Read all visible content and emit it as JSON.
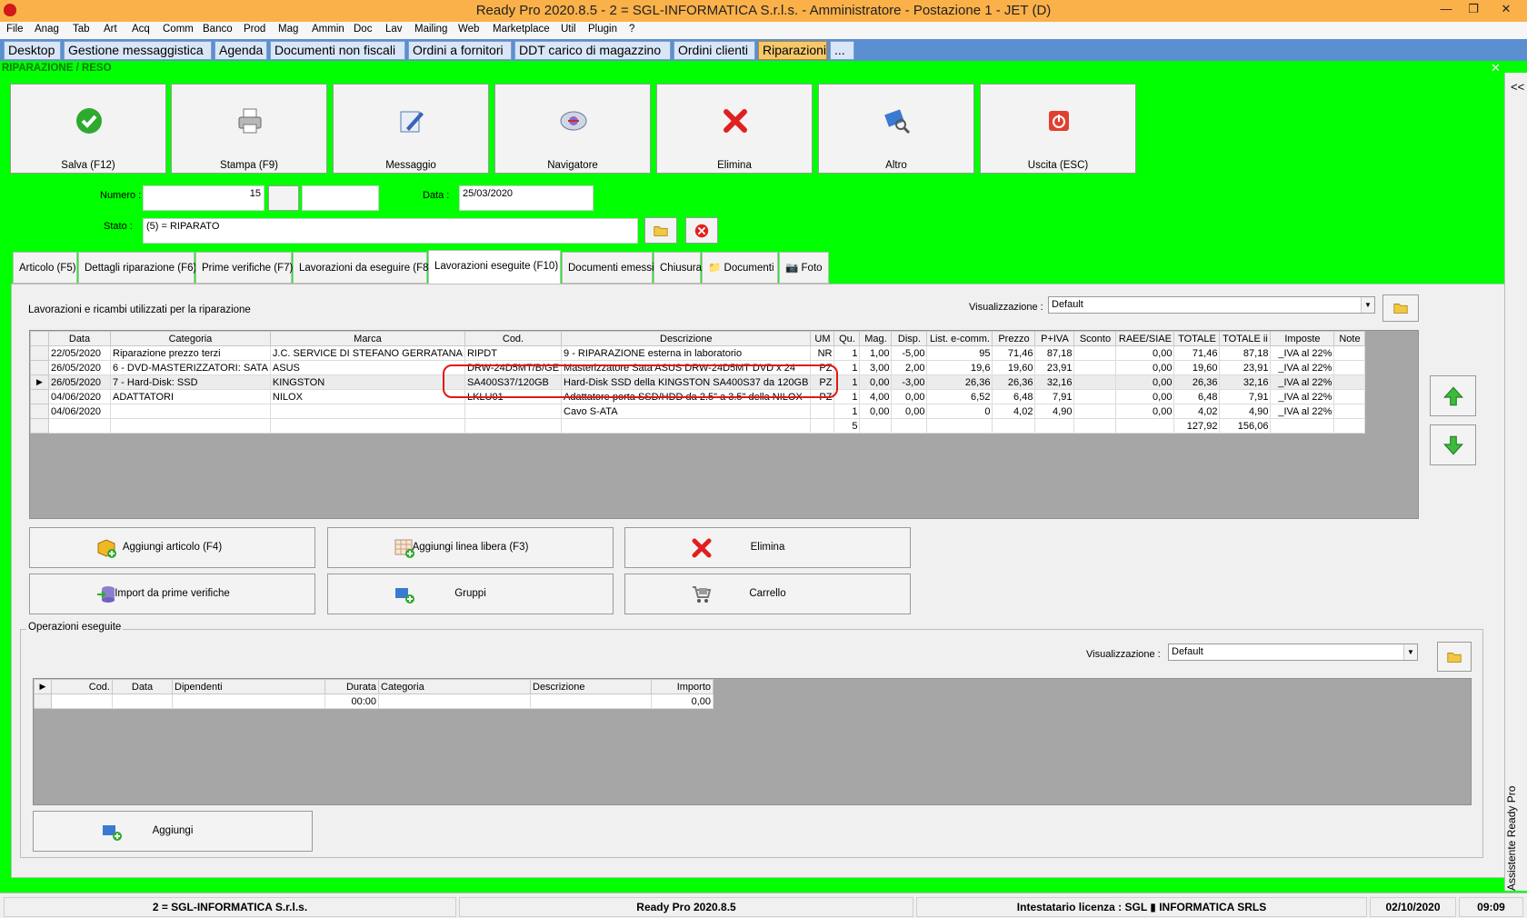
{
  "window": {
    "title": "Ready Pro 2020.8.5 - 2 = SGL-INFORMATICA S.r.l.s. - Amministratore - Postazione 1 - JET (D)",
    "minimize": "—",
    "maximize": "❐",
    "close": "✕"
  },
  "menu": [
    "File",
    "Anag",
    "Tab",
    "Art",
    "Acq",
    "Comm",
    "Banco",
    "Prod",
    "Mag",
    "Ammin",
    "Doc",
    "Lav",
    "Mailing",
    "Web",
    "Marketplace",
    "Util",
    "Plugin",
    "?"
  ],
  "tabs": [
    "Desktop",
    "Gestione messaggistica",
    "Agenda",
    "Documenti non fiscali",
    "Ordini a fornitori",
    "DDT carico di magazzino",
    "Ordini clienti",
    "Riparazioni",
    "..."
  ],
  "subwindow": {
    "title": "RIPARAZIONE / RESO",
    "close": "✕"
  },
  "toolbar": [
    "Salva (F12)",
    "Stampa (F9)",
    "Messaggio",
    "Navigatore",
    "Elimina",
    "Altro",
    "Uscita (ESC)"
  ],
  "form": {
    "numero_label": "Numero :",
    "numero": "15",
    "data_label": "Data :",
    "data": "25/03/2020",
    "stato_label": "Stato :",
    "stato": "(5) = RIPARATO"
  },
  "subtabs": [
    "Articolo (F5)",
    "Dettagli riparazione (F6)",
    "Prime verifiche (F7)",
    "Lavorazioni da eseguire (F8)",
    "Lavorazioni eseguite  (F10)",
    "Documenti emessi",
    "Chiusura",
    "Documenti",
    "Foto"
  ],
  "lavorazioni": {
    "caption": "Lavorazioni e ricambi utilizzati per la riparazione",
    "view_label": "Visualizzazione :",
    "view_value": "Default",
    "columns": [
      "Data",
      "Categoria",
      "Marca",
      "Cod.",
      "Descrizione",
      "UM",
      "Qu.",
      "Mag.",
      "Disp.",
      "List. e-comm.",
      "Prezzo",
      "P+IVA",
      "Sconto",
      "RAEE/SIAE",
      "TOTALE",
      "TOTALE ii",
      "Imposte",
      "Note"
    ],
    "rows": [
      [
        "22/05/2020",
        "Riparazione prezzo terzi",
        "J.C. SERVICE DI STEFANO GERRATANA",
        "RIPDT",
        "9 - RIPARAZIONE esterna in laboratorio",
        "NR",
        "1",
        "1,00",
        "-5,00",
        "95",
        "71,46",
        "87,18",
        "",
        "0,00",
        "71,46",
        "87,18",
        "_IVA al 22%",
        ""
      ],
      [
        "26/05/2020",
        "6 - DVD-MASTERIZZATORI: SATA",
        "ASUS",
        "DRW-24D5MT/B/GE",
        "Masterizzatore Sata ASUS DRW-24D5MT DVD x 24",
        "PZ",
        "1",
        "3,00",
        "2,00",
        "19,6",
        "19,60",
        "23,91",
        "",
        "0,00",
        "19,60",
        "23,91",
        "_IVA al 22%",
        ""
      ],
      [
        "26/05/2020",
        "7 - Hard-Disk: SSD",
        "KINGSTON",
        "SA400S37/120GB",
        "Hard-Disk SSD della KINGSTON SA400S37 da 120GB",
        "PZ",
        "1",
        "0,00",
        "-3,00",
        "26,36",
        "26,36",
        "32,16",
        "",
        "0,00",
        "26,36",
        "32,16",
        "_IVA al 22%",
        ""
      ],
      [
        "04/06/2020",
        "ADATTATORI",
        "NILOX",
        "LKLU01",
        "Adattatore porta SSD/HDD da 2.5\" a 3.5\" della NILOX",
        "PZ",
        "1",
        "4,00",
        "0,00",
        "6,52",
        "6,48",
        "7,91",
        "",
        "0,00",
        "6,48",
        "7,91",
        "_IVA al 22%",
        ""
      ],
      [
        "04/06/2020",
        "",
        "",
        "",
        "Cavo S-ATA",
        "",
        "1",
        "0,00",
        "0,00",
        "0",
        "4,02",
        "4,90",
        "",
        "0,00",
        "4,02",
        "4,90",
        "_IVA al 22%",
        ""
      ]
    ],
    "totals": {
      "qty": "5",
      "totale": "127,92",
      "totale_ii": "156,06"
    }
  },
  "actions": [
    "Aggiungi articolo (F4)",
    "Aggiungi linea libera (F3)",
    "Elimina",
    "Import da prime verifiche",
    "Gruppi",
    "Carrello"
  ],
  "operazioni": {
    "legend": "Operazioni eseguite",
    "view_label": "Visualizzazione :",
    "view_value": "Default",
    "columns": [
      "Cod.",
      "Data",
      "Dipendenti",
      "Durata",
      "Categoria",
      "Descrizione",
      "Importo"
    ],
    "row": [
      "",
      "",
      "",
      "00:00",
      "",
      "",
      "0,00"
    ],
    "add_button": "Aggiungi"
  },
  "sidepanel": {
    "collapse": "<<",
    "label": "Assistente Ready Pro"
  },
  "status": [
    "2 = SGL-INFORMATICA S.r.l.s.",
    "Ready Pro 2020.8.5",
    "Intestatario licenza : SGL ▮ INFORMATICA SRLS",
    "02/10/2020",
    "09:09"
  ]
}
